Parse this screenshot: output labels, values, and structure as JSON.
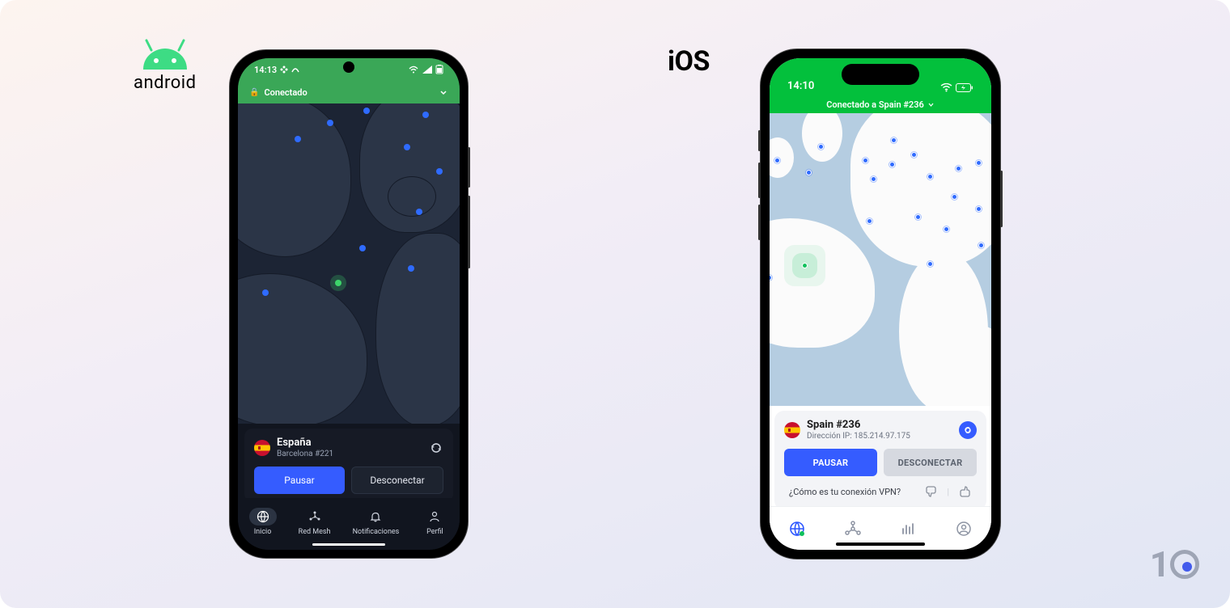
{
  "labels": {
    "android": "android",
    "ios": "iOS"
  },
  "android": {
    "status_time": "14:13",
    "header_status": "Conectado",
    "card": {
      "country": "España",
      "server": "Barcelona #221"
    },
    "buttons": {
      "pause": "Pausar",
      "disconnect": "Desconectar"
    },
    "nav": {
      "home": "Inicio",
      "mesh": "Red Mesh",
      "notif": "Notificaciones",
      "profile": "Perfil"
    }
  },
  "ios": {
    "status_time": "14:10",
    "header_status": "Conectado a Spain #236",
    "card": {
      "server": "Spain #236",
      "ip_label": "Dirección IP:",
      "ip_value": "185.214.97.175"
    },
    "buttons": {
      "pause": "PAUSAR",
      "disconnect": "DESCONECTAR"
    },
    "feedback_prompt": "¿Cómo es tu conexión VPN?"
  },
  "logo": "1"
}
